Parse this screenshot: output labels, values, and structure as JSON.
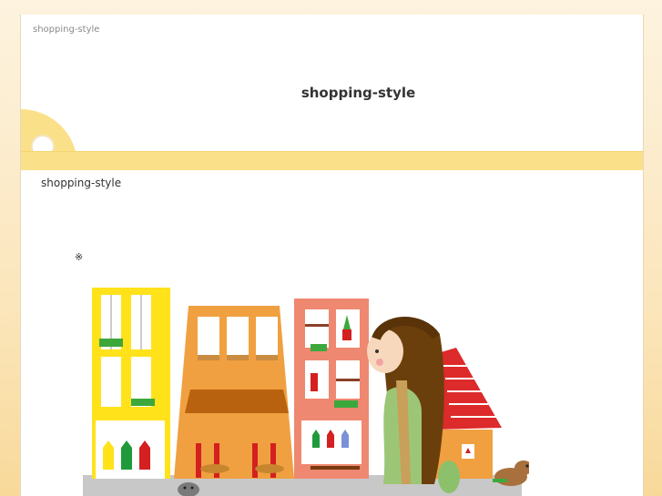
{
  "header": {
    "small_title": "shopping-style",
    "site_title": "shopping-style"
  },
  "content": {
    "label": "shopping-style",
    "mark": "※"
  },
  "colors": {
    "background": "#fbe6bc",
    "band": "#fbe08a",
    "building_yellow": "#ffe21a",
    "building_orange": "#f0a040",
    "building_salmon": "#ee8870",
    "roof_red": "#dd2a2a"
  }
}
